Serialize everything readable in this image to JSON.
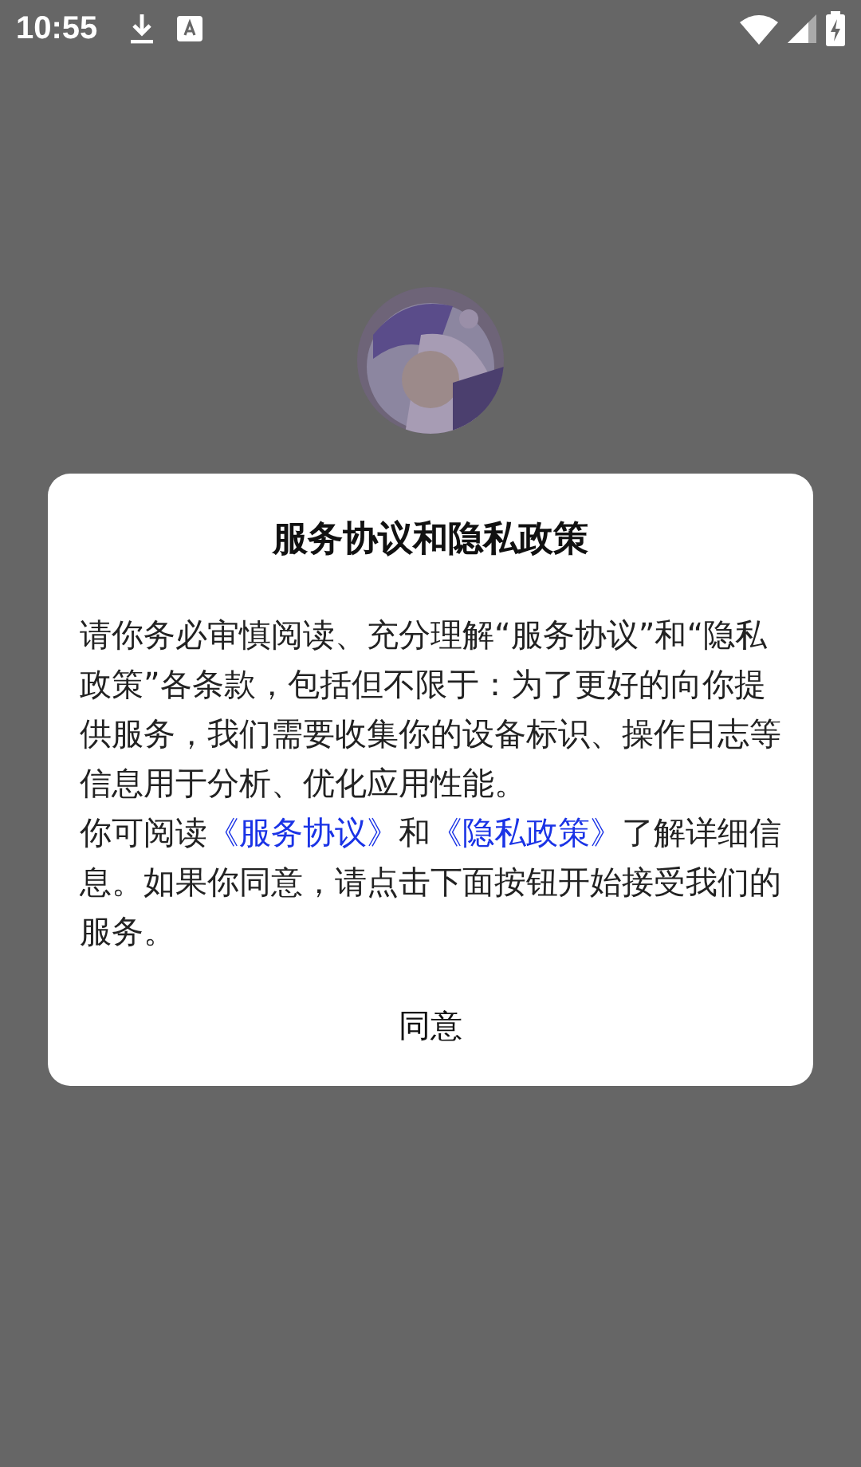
{
  "status_bar": {
    "time": "10:55"
  },
  "dialog": {
    "title": "服务协议和隐私政策",
    "paragraphs": [
      {
        "segments": [
          {
            "kind": "text",
            "text": "请你务必审慎阅读、充分理解“服务协议”和“隐私政策”各条款，包括但不限于：为了更好的向你提供服务，我们需要收集你的设备标识、操作日志等信息用于分析、优化应用性能。"
          }
        ]
      },
      {
        "segments": [
          {
            "kind": "text",
            "text": "你可阅读"
          },
          {
            "kind": "link",
            "text": "《服务协议》"
          },
          {
            "kind": "text",
            "text": "和"
          },
          {
            "kind": "link",
            "text": "《隐私政策》"
          },
          {
            "kind": "text",
            "text": "了解详细信息。如果你同意，请点击下面按钮开始接受我们的服务。"
          }
        ]
      }
    ],
    "button": "同意"
  }
}
